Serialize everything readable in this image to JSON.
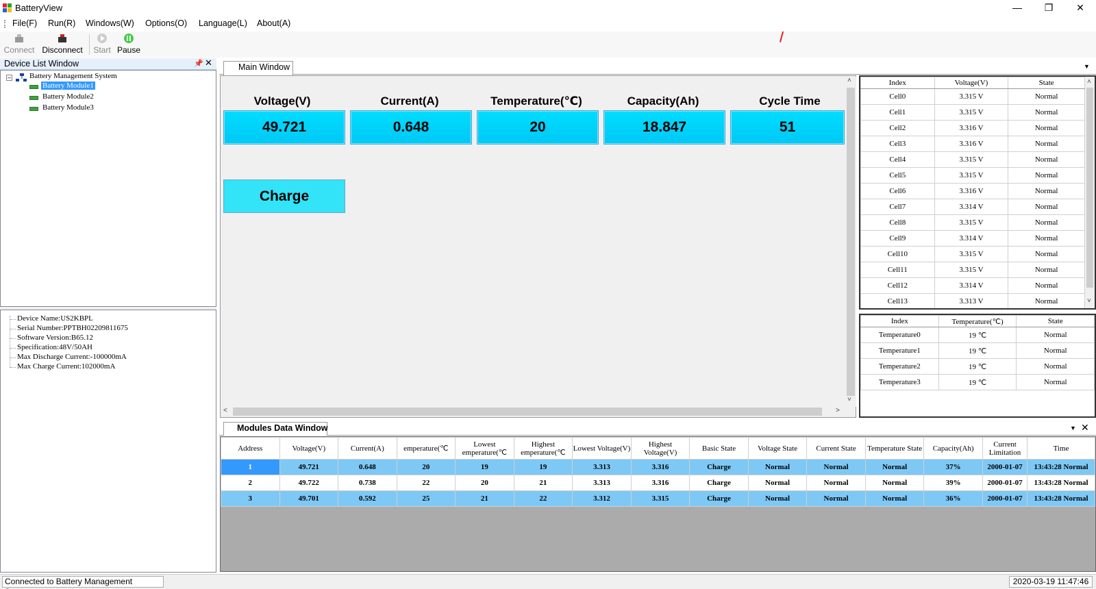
{
  "app": {
    "title": "BatteryView"
  },
  "menu": [
    "File(F)",
    "Run(R)",
    "Windows(W)",
    "Options(O)",
    "Language(L)",
    "About(A)"
  ],
  "toolbar": {
    "connect": "Connect",
    "disconnect": "Disconnect",
    "start": "Start",
    "pause": "Pause"
  },
  "device_list": {
    "title": "Device List Window",
    "root": "Battery Management System",
    "modules": [
      "Battery Module1",
      "Battery Module2",
      "Battery Module3"
    ],
    "selected": "Battery Module1"
  },
  "device_info": [
    "Device Name:US2KBPL",
    "Serial Number:PPTBH02209811675",
    "Software Version:B65.12",
    "Specification:48V/50AH",
    "Max Discharge Current:-100000mA",
    "Max Charge Current:102000mA"
  ],
  "main_window": {
    "tab": "Main Window",
    "metrics": [
      {
        "label": "Voltage(V)",
        "value": "49.721"
      },
      {
        "label": "Current(A)",
        "value": "0.648"
      },
      {
        "label": "Temperature(℃)",
        "value": "20"
      },
      {
        "label": "Capacity(Ah)",
        "value": "18.847"
      },
      {
        "label": "Cycle Time",
        "value": "51"
      }
    ],
    "state": "Charge"
  },
  "cell_table": {
    "headers": [
      "Index",
      "Voltage(V)",
      "State"
    ],
    "rows": [
      [
        "Cell0",
        "3.315 V",
        "Normal"
      ],
      [
        "Cell1",
        "3.315 V",
        "Normal"
      ],
      [
        "Cell2",
        "3.316 V",
        "Normal"
      ],
      [
        "Cell3",
        "3.316 V",
        "Normal"
      ],
      [
        "Cell4",
        "3.315 V",
        "Normal"
      ],
      [
        "Cell5",
        "3.315 V",
        "Normal"
      ],
      [
        "Cell6",
        "3.316 V",
        "Normal"
      ],
      [
        "Cell7",
        "3.314 V",
        "Normal"
      ],
      [
        "Cell8",
        "3.315 V",
        "Normal"
      ],
      [
        "Cell9",
        "3.314 V",
        "Normal"
      ],
      [
        "Cell10",
        "3.315 V",
        "Normal"
      ],
      [
        "Cell11",
        "3.315 V",
        "Normal"
      ],
      [
        "Cell12",
        "3.314 V",
        "Normal"
      ],
      [
        "Cell13",
        "3.313 V",
        "Normal"
      ]
    ]
  },
  "temp_table": {
    "headers": [
      "Index",
      "Temperature(℃)",
      "State"
    ],
    "rows": [
      [
        "Temperature0",
        "19 ℃",
        "Normal"
      ],
      [
        "Temperature1",
        "19 ℃",
        "Normal"
      ],
      [
        "Temperature2",
        "19 ℃",
        "Normal"
      ],
      [
        "Temperature3",
        "19 ℃",
        "Normal"
      ]
    ]
  },
  "modules_window": {
    "tab": "Modules Data Window",
    "headers": [
      "Address",
      "Voltage(V)",
      "Current(A)",
      "emperature(℃",
      "Lowest emperature(℃",
      "Highest emperature(℃",
      "Lowest Voltage(V)",
      "Highest Voltage(V)",
      "Basic State",
      "Voltage State",
      "Current State",
      "Temperature State",
      "Capacity(Ah)",
      "Current Limitation",
      "Time"
    ],
    "rows": [
      [
        "1",
        "49.721",
        "0.648",
        "20",
        "19",
        "19",
        "3.313",
        "3.316",
        "Charge",
        "Normal",
        "Normal",
        "Normal",
        "37%",
        "2000-01-07",
        "13:43:28 Normal"
      ],
      [
        "2",
        "49.722",
        "0.738",
        "22",
        "20",
        "21",
        "3.313",
        "3.316",
        "Charge",
        "Normal",
        "Normal",
        "Normal",
        "39%",
        "2000-01-07",
        "13:43:28 Normal"
      ],
      [
        "3",
        "49.701",
        "0.592",
        "25",
        "21",
        "22",
        "3.312",
        "3.315",
        "Charge",
        "Normal",
        "Normal",
        "Normal",
        "36%",
        "2000-01-07",
        "13:43:28 Normal"
      ]
    ]
  },
  "status": {
    "message": "Connected to Battery Management System.",
    "datetime": "2020-03-19 11:47:46"
  },
  "colors": {
    "metric_bg": "#00d4fa",
    "charge_bg": "#33e3f8",
    "row_highlight": "#7ec8f5",
    "selection": "#3399ff"
  },
  "icons": {
    "pin": "pin-icon",
    "close": "close-icon",
    "minimize": "minimize-icon",
    "restore": "restore-icon",
    "dropdown": "chevron-down-icon"
  }
}
